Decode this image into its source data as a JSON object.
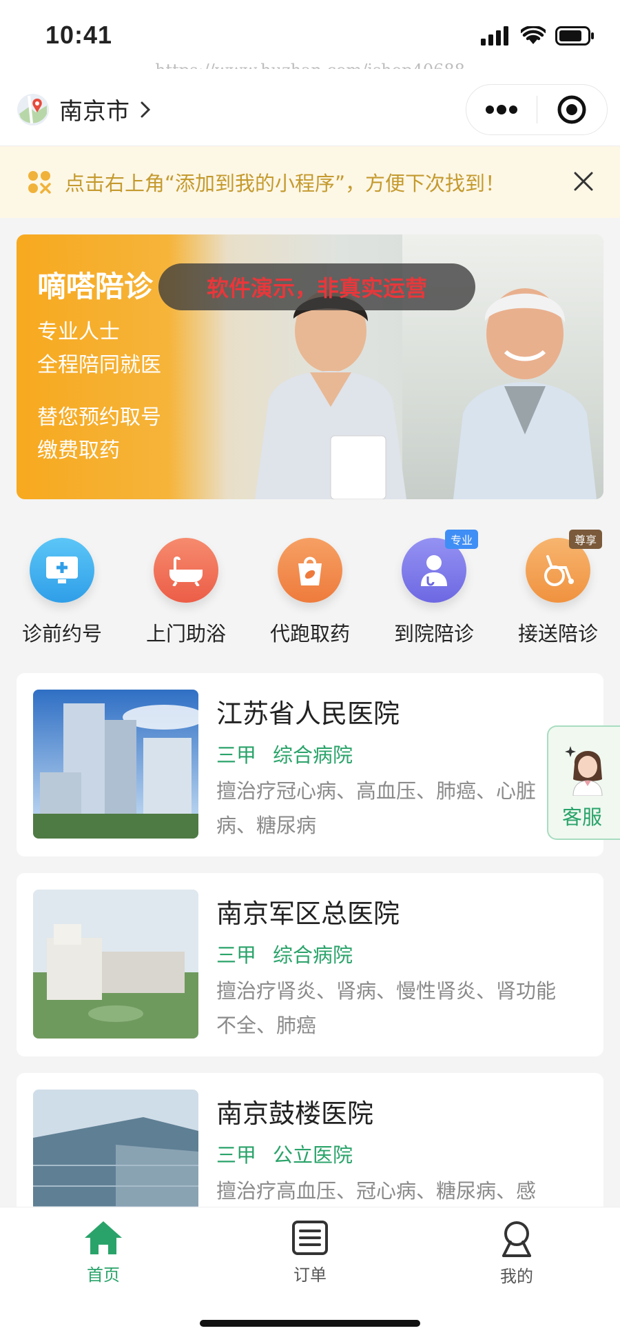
{
  "status": {
    "time": "10:41"
  },
  "watermark": "https://www.huzhan.com/ishop40688",
  "nav": {
    "city": "南京市"
  },
  "tip": {
    "text": "点击右上角“添加到我的小程序”，方便下次找到！"
  },
  "banner": {
    "title": "嘀嗒陪诊",
    "overlay": "软件演示，非真实运营",
    "lines": [
      "专业人士",
      "全程陪同就医",
      "替您预约取号",
      "缴费取药"
    ]
  },
  "categories": [
    {
      "label": "诊前约号",
      "icon": "monitor-plus-icon",
      "color": "#3fb2f0"
    },
    {
      "label": "上门助浴",
      "icon": "bathtub-icon",
      "color": "#f2765a"
    },
    {
      "label": "代跑取药",
      "icon": "medicine-bag-icon",
      "color": "#f08a4b"
    },
    {
      "label": "到院陪诊",
      "icon": "doctor-icon",
      "color": "#7b78ea",
      "badge": "专业"
    },
    {
      "label": "接送陪诊",
      "icon": "wheelchair-icon",
      "color": "#f4a45a",
      "badge": "尊享"
    }
  ],
  "hospitals": [
    {
      "name": "江苏省人民医院",
      "grade": "三甲",
      "type": "综合病院",
      "desc": "擅治疗冠心病、高血压、肺癌、心脏病、糖尿病"
    },
    {
      "name": "南京军区总医院",
      "grade": "三甲",
      "type": "综合病院",
      "desc": "擅治疗肾炎、肾病、慢性肾炎、肾功能不全、肺癌"
    },
    {
      "name": "南京鼓楼医院",
      "grade": "三甲",
      "type": "公立医院",
      "desc": "擅治疗高血压、冠心病、糖尿病、感"
    }
  ],
  "service": {
    "label": "客服"
  },
  "tabs": [
    {
      "label": "首页",
      "icon": "home-icon",
      "active": true
    },
    {
      "label": "订单",
      "icon": "order-list-icon",
      "active": false
    },
    {
      "label": "我的",
      "icon": "profile-icon",
      "active": false
    }
  ],
  "colors": {
    "brand_green": "#2aa36a",
    "tip_text": "#c49a2e",
    "tip_bg": "#fdf7e6",
    "banner_orange": "#f7a91f"
  }
}
